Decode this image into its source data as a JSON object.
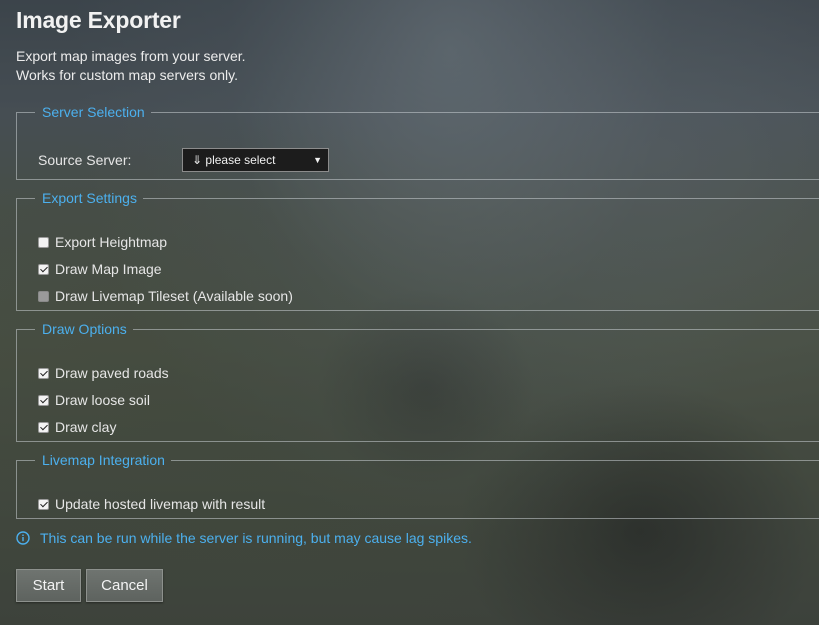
{
  "page": {
    "title": "Image Exporter",
    "description_lines": [
      "Export map images from your server.",
      "Works for custom map servers only."
    ]
  },
  "server_selection": {
    "legend": "Server Selection",
    "source_label": "Source Server:",
    "select_value": "⇓ please select"
  },
  "export_settings": {
    "legend": "Export Settings",
    "options": [
      {
        "label": "Export Heightmap",
        "checked": false,
        "disabled": false
      },
      {
        "label": "Draw Map Image",
        "checked": true,
        "disabled": false
      },
      {
        "label": "Draw Livemap Tileset (Available soon)",
        "checked": false,
        "disabled": true
      }
    ]
  },
  "draw_options": {
    "legend": "Draw Options",
    "options": [
      {
        "label": "Draw paved roads",
        "checked": true
      },
      {
        "label": "Draw loose soil",
        "checked": true
      },
      {
        "label": "Draw clay",
        "checked": true
      }
    ]
  },
  "livemap_integration": {
    "legend": "Livemap Integration",
    "options": [
      {
        "label": "Update hosted livemap with result",
        "checked": true
      }
    ]
  },
  "info": {
    "icon": "info-circle-icon",
    "text": "This can be run while the server is running, but may cause lag spikes."
  },
  "buttons": {
    "start": "Start",
    "cancel": "Cancel"
  },
  "colors": {
    "accent": "#4cb0ee"
  }
}
